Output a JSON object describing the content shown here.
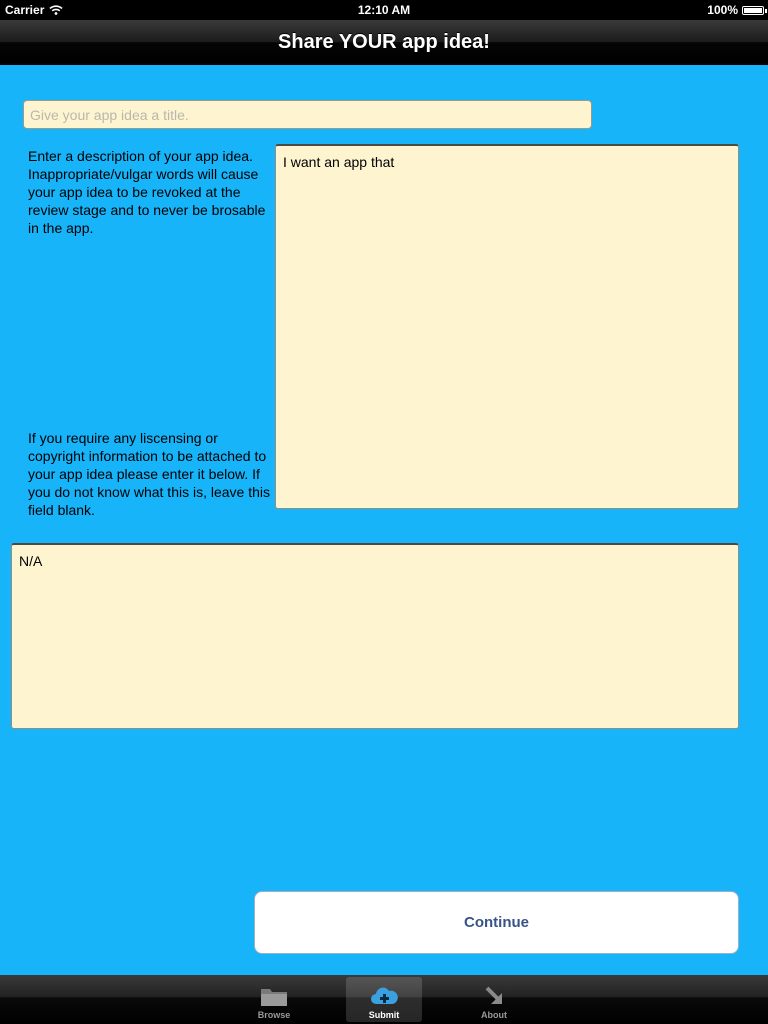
{
  "status_bar": {
    "carrier": "Carrier",
    "time": "12:10 AM",
    "battery": "100%"
  },
  "nav": {
    "title": "Share YOUR app idea!"
  },
  "form": {
    "title_placeholder": "Give your app idea a title.",
    "title_value": "",
    "description_label": "Enter a description of your app idea. Inappropriate/vulgar words will cause your app idea to be revoked at the review stage and to never be brosable in the app.",
    "description_value": "I want an app that",
    "license_label": "If you require any liscensing or copyright information to be attached to your app idea please enter it below. If you do not know what this is, leave this field blank.",
    "license_value": "N/A",
    "continue_label": "Continue"
  },
  "tabs": [
    {
      "label": "Browse",
      "icon": "folder-icon",
      "selected": false
    },
    {
      "label": "Submit",
      "icon": "cloud-upload-icon",
      "selected": true
    },
    {
      "label": "About",
      "icon": "arrow-icon",
      "selected": false
    }
  ],
  "colors": {
    "background": "#17b4fa",
    "field_background": "#fef4cf",
    "button_text": "#385487"
  }
}
